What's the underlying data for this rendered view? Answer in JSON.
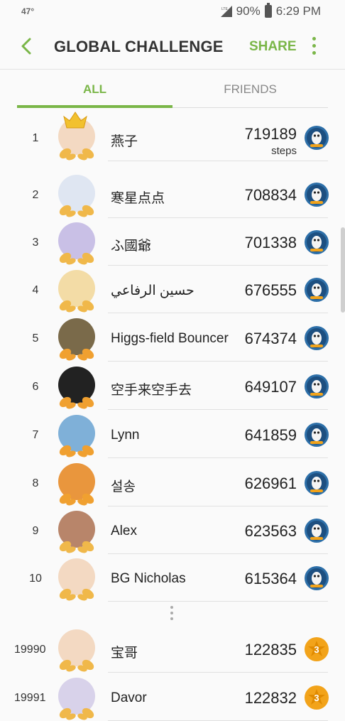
{
  "status_bar": {
    "temperature": "47°",
    "network": "LTE",
    "battery": "90%",
    "time": "6:29 PM"
  },
  "header": {
    "title": "GLOBAL CHALLENGE",
    "share_label": "SHARE"
  },
  "tabs": [
    {
      "label": "ALL",
      "selected": true
    },
    {
      "label": "FRIENDS",
      "selected": false
    }
  ],
  "colors": {
    "accent": "#7ab648",
    "badge_blue": "#2d6fa8",
    "badge_orange": "#f2a31a"
  },
  "leaderboard": [
    {
      "rank": "1",
      "name": "燕子",
      "steps": "719189",
      "unit": "steps",
      "badge": "owl-badge-icon",
      "crown": true
    },
    {
      "rank": "2",
      "name": "寒星点点",
      "steps": "708834",
      "badge": "owl-badge-icon"
    },
    {
      "rank": "3",
      "name": "ふ國爺",
      "steps": "701338",
      "badge": "owl-badge-icon"
    },
    {
      "rank": "4",
      "name": "حسين الرفاعي",
      "steps": "676555",
      "badge": "owl-badge-icon"
    },
    {
      "rank": "5",
      "name": "Higgs-field Bouncer",
      "steps": "674374",
      "badge": "owl-badge-icon"
    },
    {
      "rank": "6",
      "name": "空手来空手去",
      "steps": "649107",
      "badge": "owl-badge-icon"
    },
    {
      "rank": "7",
      "name": "Lynn",
      "steps": "641859",
      "badge": "owl-badge-icon"
    },
    {
      "rank": "8",
      "name": "설송",
      "steps": "626961",
      "badge": "owl-badge-icon"
    },
    {
      "rank": "9",
      "name": "Alex",
      "steps": "623563",
      "badge": "owl-badge-icon"
    },
    {
      "rank": "10",
      "name": "BG Nicholas",
      "steps": "615364",
      "badge": "owl-badge-icon"
    },
    {
      "rank": "19990",
      "name": "宝哥",
      "steps": "122835",
      "badge": "level-3-badge-icon",
      "badge_level": "3"
    },
    {
      "rank": "19991",
      "name": "Davor",
      "steps": "122832",
      "badge": "level-3-badge-icon",
      "badge_level": "3"
    }
  ]
}
